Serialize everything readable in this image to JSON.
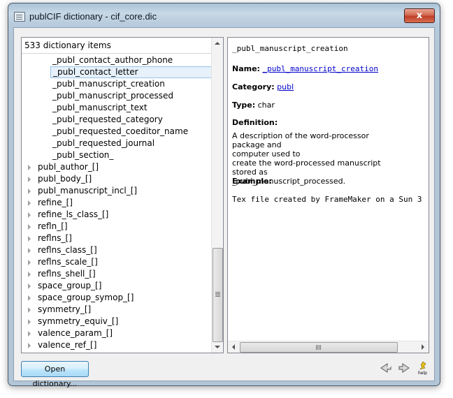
{
  "window": {
    "title": "publCIF dictionary - cif_core.dic",
    "close_label": "x"
  },
  "tree": {
    "header": "533 dictionary items",
    "children": [
      "_publ_contact_author_phone",
      "_publ_contact_letter",
      "_publ_manuscript_creation",
      "_publ_manuscript_processed",
      "_publ_manuscript_text",
      "_publ_requested_category",
      "_publ_requested_coeditor_name",
      "_publ_requested_journal",
      "_publ_section_"
    ],
    "selected_index": 1,
    "categories": [
      "publ_author_[]",
      "publ_body_[]",
      "publ_manuscript_incl_[]",
      "refine_[]",
      "refine_ls_class_[]",
      "refln_[]",
      "reflns_[]",
      "reflns_class_[]",
      "reflns_scale_[]",
      "reflns_shell_[]",
      "space_group_[]",
      "space_group_symop_[]",
      "symmetry_[]",
      "symmetry_equiv_[]",
      "valence_param_[]",
      "valence_ref_[]"
    ]
  },
  "detail": {
    "title": "_publ_manuscript_creation",
    "name_label": "Name:",
    "name_value": "_publ_manuscript_creation",
    "category_label": "Category:",
    "category_value": "publ",
    "type_label": "Type:",
    "type_value": "char",
    "definition_label": "Definition:",
    "definition_lines": [
      "A description of the word-processor package and",
      "computer used to",
      "create the word-processed manuscript stored as",
      "_publ_manuscript_processed."
    ],
    "example_label": "Example:",
    "example_text": "Tex file created by FrameMaker on a Sun 3"
  },
  "footer": {
    "open_button": "Open dictionary...",
    "back_icon": "back-arrow-icon",
    "forward_icon": "forward-arrow-icon",
    "help_icon": "help-icon",
    "help_text": "help"
  }
}
